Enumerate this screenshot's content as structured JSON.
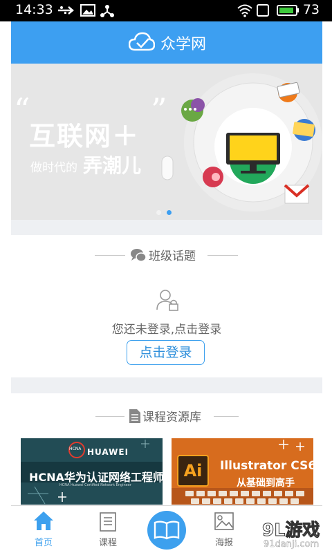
{
  "status_bar": {
    "time": "14:33",
    "battery_level": "73",
    "icons": [
      "usb-icon",
      "image-icon",
      "share-icon",
      "wifi-icon",
      "sim-icon",
      "battery-icon"
    ]
  },
  "header": {
    "title": "众学网",
    "logo_icon": "cloud-check-icon",
    "color": "#3d9ff1"
  },
  "banner": {
    "quote_open": "“",
    "quote_close": "”",
    "headline": "互联网＋",
    "subline_prefix": "做时代的",
    "subline_emphasis": "弄潮儿",
    "active_slide": 2,
    "slide_count": 2
  },
  "class_topics": {
    "title": "班级话题",
    "icon": "chat-bubble-icon",
    "login_message": "您还未登录,点击登录",
    "login_button": "点击登录"
  },
  "course_library": {
    "title": "课程资源库",
    "icon": "document-icon",
    "courses": [
      {
        "badge": "HCNA",
        "brand": "HUAWEI",
        "title": "HCNA华为认证网络工程师",
        "subtitle": "HCNA Huawei Certified Network Engineer"
      },
      {
        "badge": "Ai",
        "title": "Illustrator CS6",
        "subtitle": "从基础到高手"
      }
    ]
  },
  "tab_bar": {
    "tabs": [
      {
        "label": "首页",
        "icon": "home-icon",
        "active": true
      },
      {
        "label": "课程",
        "icon": "course-list-icon",
        "active": false
      },
      {
        "label": "",
        "icon": "open-book-icon",
        "active": false
      },
      {
        "label": "海报",
        "icon": "poster-image-icon",
        "active": false
      }
    ],
    "active_color": "#3da0ee"
  },
  "watermark": {
    "main": "9L游戏",
    "site": "91danji.com"
  }
}
